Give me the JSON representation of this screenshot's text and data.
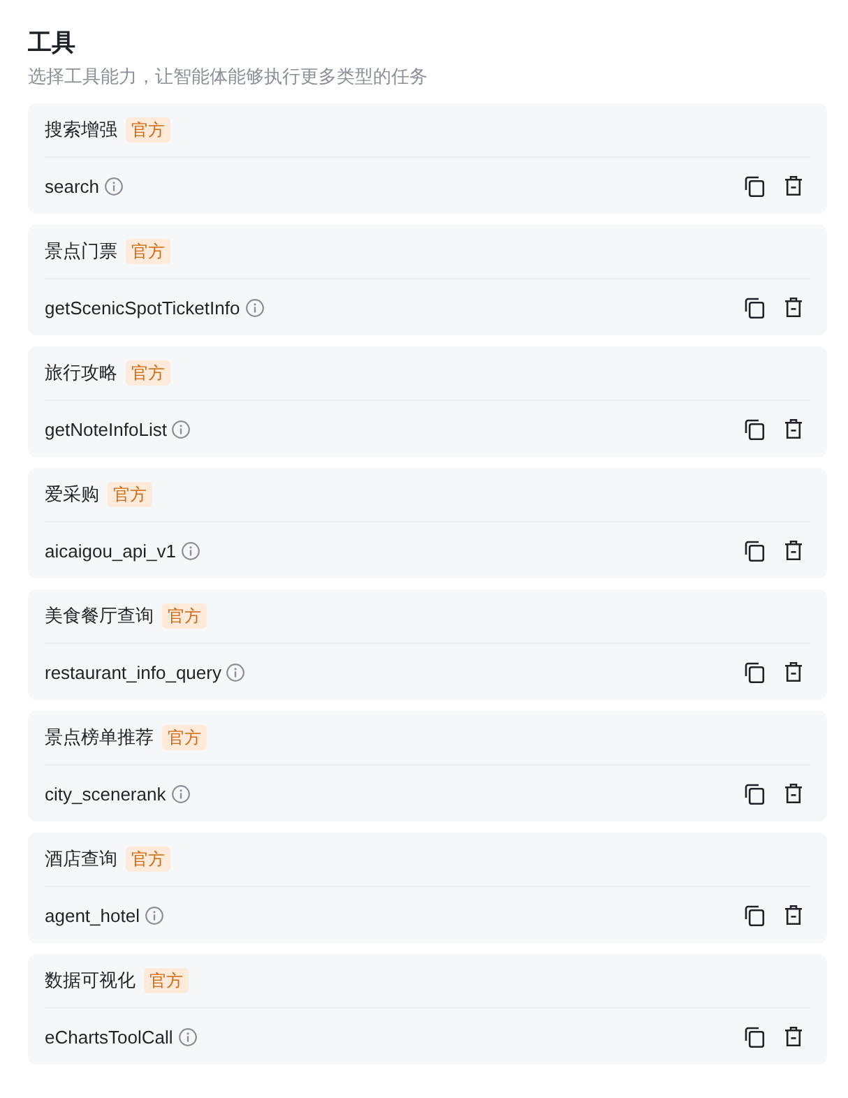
{
  "header": {
    "title": "工具",
    "subtitle": "选择工具能力，让智能体能够执行更多类型的任务"
  },
  "tools": [
    {
      "title": "搜索增强",
      "badge": "官方",
      "name": "search"
    },
    {
      "title": "景点门票",
      "badge": "官方",
      "name": "getScenicSpotTicketInfo"
    },
    {
      "title": "旅行攻略",
      "badge": "官方",
      "name": "getNoteInfoList"
    },
    {
      "title": "爱采购",
      "badge": "官方",
      "name": "aicaigou_api_v1"
    },
    {
      "title": "美食餐厅查询",
      "badge": "官方",
      "name": "restaurant_info_query"
    },
    {
      "title": "景点榜单推荐",
      "badge": "官方",
      "name": "city_scenerank"
    },
    {
      "title": "酒店查询",
      "badge": "官方",
      "name": "agent_hotel"
    },
    {
      "title": "数据可视化",
      "badge": "官方",
      "name": "eChartsToolCall"
    }
  ]
}
